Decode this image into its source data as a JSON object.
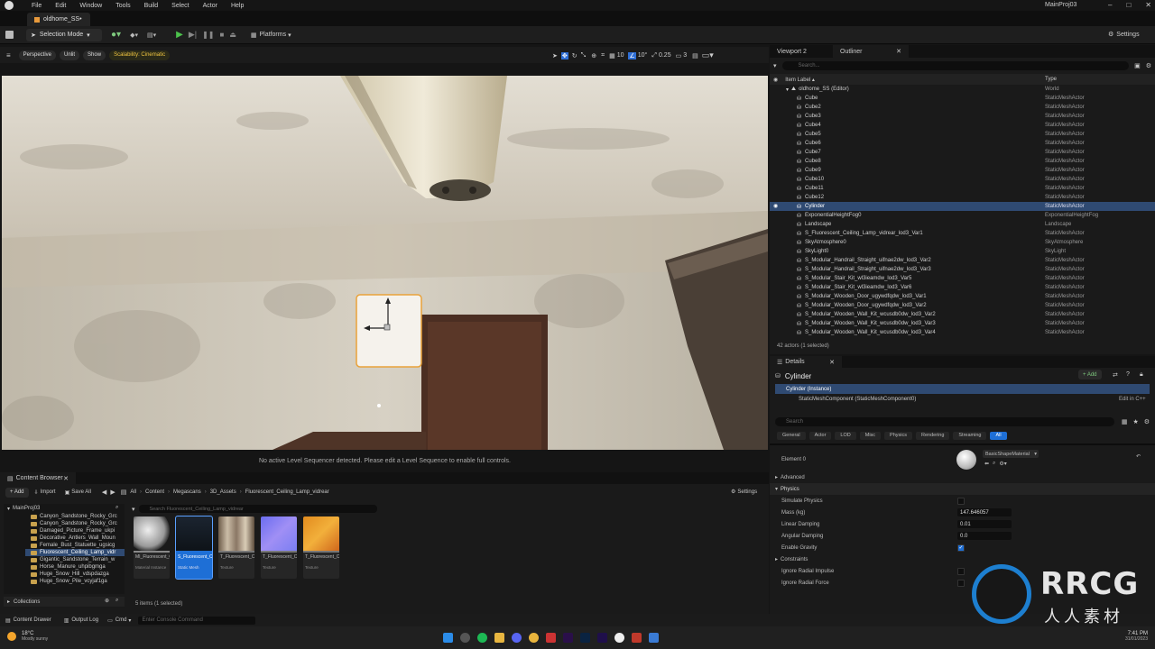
{
  "menu": [
    "File",
    "Edit",
    "Window",
    "Tools",
    "Build",
    "Select",
    "Actor",
    "Help"
  ],
  "project_name": "MainProj03",
  "doc_tab": "oldhome_SS•",
  "toolbar": {
    "mode": "Selection Mode",
    "platforms": "Platforms",
    "settings": "Settings"
  },
  "viewport": {
    "perspective": "Perspective",
    "unlit": "Unlit",
    "show": "Show",
    "scalability": "Scalability: Cinematic",
    "grid": "10",
    "angle": "10°",
    "scale": "0.25",
    "cam": "3",
    "sequencer_msg": "No active Level Sequencer detected. Please edit a Level Sequence to enable full controls."
  },
  "outliner": {
    "tabs": [
      "Viewport 2",
      "Outliner"
    ],
    "search_placeholder": "Search...",
    "col_label": "Item Label ▴",
    "col_type": "Type",
    "world": {
      "label": "oldhome_SS (Editor)",
      "type": "World"
    },
    "rows": [
      {
        "label": "Cube",
        "type": "StaticMeshActor"
      },
      {
        "label": "Cube2",
        "type": "StaticMeshActor"
      },
      {
        "label": "Cube3",
        "type": "StaticMeshActor"
      },
      {
        "label": "Cube4",
        "type": "StaticMeshActor"
      },
      {
        "label": "Cube5",
        "type": "StaticMeshActor"
      },
      {
        "label": "Cube6",
        "type": "StaticMeshActor"
      },
      {
        "label": "Cube7",
        "type": "StaticMeshActor"
      },
      {
        "label": "Cube8",
        "type": "StaticMeshActor"
      },
      {
        "label": "Cube9",
        "type": "StaticMeshActor"
      },
      {
        "label": "Cube10",
        "type": "StaticMeshActor"
      },
      {
        "label": "Cube11",
        "type": "StaticMeshActor"
      },
      {
        "label": "Cube12",
        "type": "StaticMeshActor"
      },
      {
        "label": "Cylinder",
        "type": "StaticMeshActor"
      },
      {
        "label": "ExponentialHeightFog0",
        "type": "ExponentialHeightFog"
      },
      {
        "label": "Landscape",
        "type": "Landscape"
      },
      {
        "label": "S_Fluorescent_Ceiling_Lamp_vidrear_lod3_Var1",
        "type": "StaticMeshActor"
      },
      {
        "label": "SkyAtmosphere0",
        "type": "SkyAtmosphere"
      },
      {
        "label": "SkyLight0",
        "type": "SkyLight"
      },
      {
        "label": "S_Modular_Handrail_Straight_uifnae2dw_lod3_Var2",
        "type": "StaticMeshActor"
      },
      {
        "label": "S_Modular_Handrail_Straight_uifnae2dw_lod3_Var3",
        "type": "StaticMeshActor"
      },
      {
        "label": "S_Modular_Stair_Kit_wl3ieamdw_lod3_Var5",
        "type": "StaticMeshActor"
      },
      {
        "label": "S_Modular_Stair_Kit_wl3ieamdw_lod3_Var6",
        "type": "StaticMeshActor"
      },
      {
        "label": "S_Modular_Wooden_Door_ugywdfqdw_lod3_Var1",
        "type": "StaticMeshActor"
      },
      {
        "label": "S_Modular_Wooden_Door_ugywdfqdw_lod3_Var2",
        "type": "StaticMeshActor"
      },
      {
        "label": "S_Modular_Wooden_Wall_Kit_wcusdb0dw_lod3_Var2",
        "type": "StaticMeshActor"
      },
      {
        "label": "S_Modular_Wooden_Wall_Kit_wcusdb0dw_lod3_Var3",
        "type": "StaticMeshActor"
      },
      {
        "label": "S_Modular_Wooden_Wall_Kit_wcusdb0dw_lod3_Var4",
        "type": "StaticMeshActor"
      }
    ],
    "selected_index": 12,
    "footer": "42 actors (1 selected)"
  },
  "details": {
    "tab": "Details",
    "actor": "Cylinder",
    "add": "+ Add",
    "instance": "Cylinder (Instance)",
    "component": "StaticMeshComponent (StaticMeshComponent0)",
    "edit_cpp": "Edit in C++",
    "search_placeholder": "Search",
    "filters": [
      "General",
      "Actor",
      "LOD",
      "Misc",
      "Physics",
      "Rendering",
      "Streaming",
      "All"
    ],
    "element0": "Element 0",
    "material": "BasicShapeMaterial",
    "advanced": "Advanced",
    "physics": "Physics",
    "fields": [
      {
        "label": "Simulate Physics",
        "kind": "check"
      },
      {
        "label": "Mass (kg)",
        "kind": "value",
        "value": "147.646057"
      },
      {
        "label": "Linear Damping",
        "kind": "value",
        "value": "0.01"
      },
      {
        "label": "Angular Damping",
        "kind": "value",
        "value": "0.0"
      },
      {
        "label": "Enable Gravity",
        "kind": "checked"
      },
      {
        "label": "Constraints",
        "kind": "section"
      },
      {
        "label": "Ignore Radial Impulse",
        "kind": "check"
      },
      {
        "label": "Ignore Radial Force",
        "kind": "check"
      }
    ]
  },
  "content_browser": {
    "tab": "Content Browser",
    "add": "+ Add",
    "import": "Import",
    "save_all": "Save All",
    "path": [
      "All",
      "Content",
      "Megascans",
      "3D_Assets",
      "Fluorescent_Ceiling_Lamp_vidrear"
    ],
    "settings": "Settings",
    "root": "MainProj03",
    "search_placeholder": "Search Fluorescent_Ceiling_Lamp_vidrear",
    "folders": [
      "Canyon_Sandstone_Rocky_Grc",
      "Canyon_Sandstone_Rocky_Grc",
      "Damaged_Picture_Frame_ukpi",
      "Decorative_Antlers_Wall_Moun",
      "Female_Bust_Statuette_ugsicg",
      "Fluorescent_Ceiling_Lamp_vidr",
      "Gigantic_Sandstone_Terrain_w",
      "Horse_Manure_uhpibgmga",
      "Huge_Snow_Hill_vdspdazga",
      "Huge_Snow_Pile_vcyjaf1ga"
    ],
    "selected_folder": 5,
    "collections": "Collections",
    "assets": [
      {
        "name": "MI_Fluorescent_Ceiling_Lamp...",
        "type": "Material Instance",
        "color": "#888"
      },
      {
        "name": "S_Fluorescent_Ceiling_Lamp...",
        "type": "Static Mesh",
        "color": "#1e6fd6"
      },
      {
        "name": "T_Fluorescent_Ceiling_Lamp...",
        "type": "Texture",
        "color": "#777"
      },
      {
        "name": "T_Fluorescent_Ceiling_Lamp...",
        "type": "Texture",
        "color": "#777"
      },
      {
        "name": "T_Fluorescent_Ceiling_Lamp...",
        "type": "Texture",
        "color": "#777"
      }
    ],
    "footer": "5 items (1 selected)"
  },
  "statusbar": {
    "drawer": "Content Drawer",
    "output": "Output Log",
    "cmd": "Cmd",
    "console_placeholder": "Enter Console Command"
  },
  "taskbar": {
    "temp": "18°C",
    "weather": "Mostly sunny",
    "time": "7:41 PM",
    "date": "31/01/2023"
  },
  "watermark": {
    "brand": "RRCG",
    "sub": "人人素材"
  }
}
